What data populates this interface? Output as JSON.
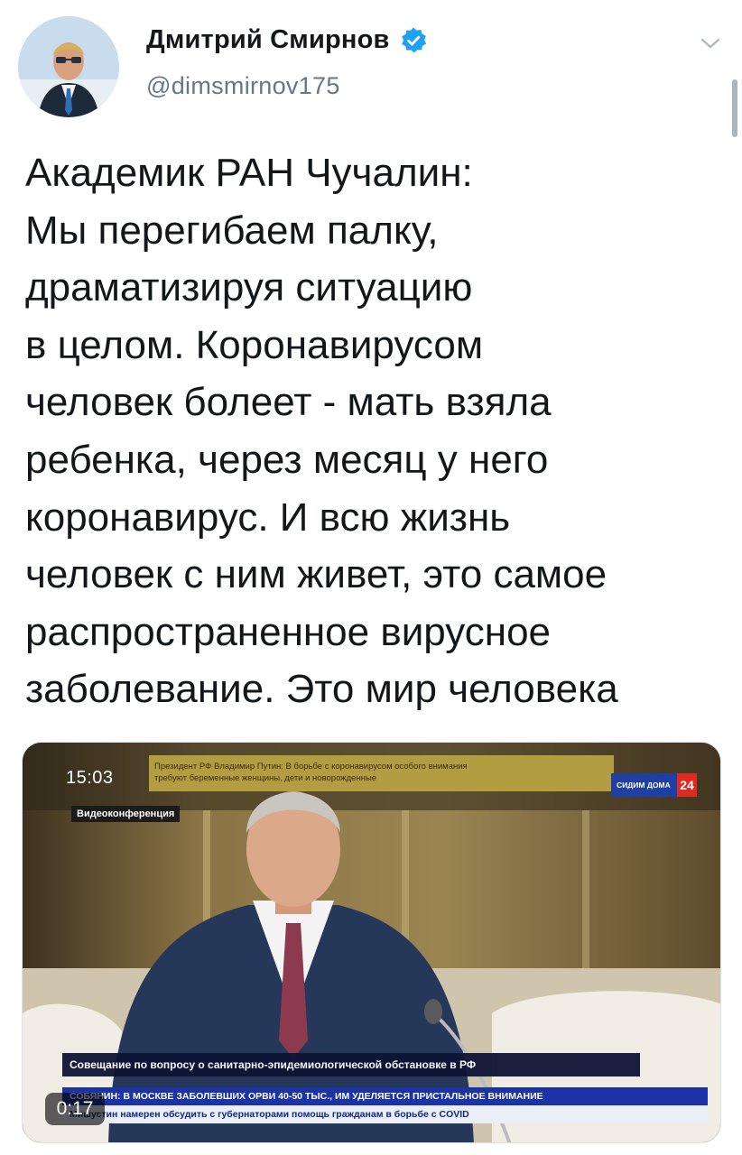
{
  "author": {
    "display_name": "Дмитрий Смирнов",
    "handle": "@dimsmirnov175",
    "verified": true,
    "avatar_icon": "profile-photo"
  },
  "tweet": {
    "lines": [
      "Академик РАН Чучалин:",
      "Мы перегибаем палку,",
      "драматизируя ситуацию",
      "в целом. Коронавирусом",
      "человек болеет - мать взяла",
      "ребенка, через месяц у него",
      "коронавирус. И всю жизнь",
      "человек с ним живет, это самое",
      "распространенное вирусное",
      "заболевание. Это мир человека"
    ]
  },
  "media": {
    "type": "video",
    "duration": "0:17",
    "overlay": {
      "clock": "15:03",
      "ticker_top": [
        "Президент РФ Владимир Путин: В борьбе с коронавирусом особого внимания",
        "требуют беременные женщины, дети и новорожденные"
      ],
      "channel_label": "СИДИМ ДОМА",
      "channel_number": "24",
      "tag": "Видеоконференция",
      "caption": "Совещание по вопросу о санитарно-эпидемиологической обстановке в РФ",
      "news_line_1": "СОБЯНИН: В МОСКВЕ ЗАБОЛЕВШИХ ОРВИ 40-50 ТЫС., ИМ УДЕЛЯЕТСЯ ПРИСТАЛЬНОЕ ВНИМАНИЕ",
      "news_line_2": "Мишустин намерен обсудить с губернаторами помощь гражданам в борьбе с COVID"
    }
  },
  "colors": {
    "text": "#14171a",
    "secondary": "#657786",
    "verified_blue": "#1da1f2",
    "channel_blue": "#1f3fa4",
    "channel_red": "#e02a20"
  }
}
